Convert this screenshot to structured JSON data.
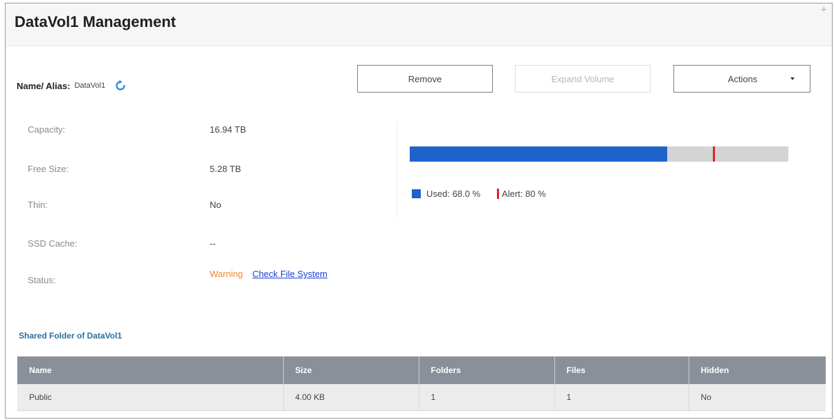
{
  "window": {
    "title": "DataVol1 Management",
    "corner_icon": "plus-icon"
  },
  "name": {
    "label": "Name/ Alias:",
    "value": "DataVol1",
    "refresh_icon": "refresh-icon"
  },
  "toolbar": {
    "remove_label": "Remove",
    "expand_label": "Expand Volume",
    "expand_enabled": false,
    "actions_label": "Actions"
  },
  "info": {
    "capacity_label": "Capacity:",
    "capacity_value": "16.94 TB",
    "free_label": "Free Size:",
    "free_value": "5.28 TB",
    "thin_label": "Thin:",
    "thin_value": "No",
    "ssd_label": "SSD Cache:",
    "ssd_value": "--",
    "status_label": "Status:",
    "status_value": "Warning",
    "status_link": "Check File System"
  },
  "usage": {
    "used_percent": 68.0,
    "alert_percent": 80,
    "used_label": "Used: 68.0 %",
    "alert_label": "Alert: 80 %",
    "used_color": "#1e63c9",
    "alert_color": "#e02424",
    "track_color": "#d4d4d4"
  },
  "shared": {
    "section_title": "Shared Folder of DataVol1",
    "columns": [
      "Name",
      "Size",
      "Folders",
      "Files",
      "Hidden"
    ],
    "rows": [
      [
        "Public",
        "4.00 KB",
        "1",
        "1",
        "No"
      ]
    ]
  },
  "colors": {
    "status_warning": "#f08a24",
    "link": "#1a3fd6",
    "section_title": "#2a6f9e",
    "table_header": "#8a9099"
  }
}
